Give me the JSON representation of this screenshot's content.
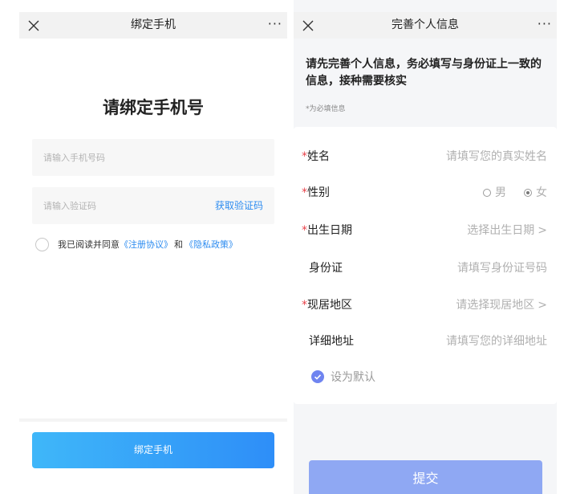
{
  "bind_phone": {
    "nav_title": "绑定手机",
    "more": "···",
    "page_title": "请绑定手机号",
    "phone_placeholder": "请输入手机号码",
    "code_placeholder": "请输入验证码",
    "get_code": "获取验证码",
    "agree_prefix": "我已阅读并同意",
    "register_agreement": "《注册协议》",
    "and": "和",
    "privacy_policy": "《隐私政策》",
    "submit": "绑定手机"
  },
  "profile": {
    "nav_title": "完善个人信息",
    "more": "···",
    "intro": "请先完善个人信息，务必填写与身份证上一致的信息，接种需要核实",
    "required_note": "*为必填信息",
    "fields": [
      {
        "required": true,
        "label": "姓名",
        "value": "请填写您的真实姓名"
      },
      {
        "required": true,
        "label": "性别",
        "options": [
          "男",
          "女"
        ],
        "selected": "女"
      },
      {
        "required": true,
        "label": "出生日期",
        "value": "选择出生日期"
      },
      {
        "required": false,
        "label": "身份证",
        "value": "请填写身份证号码"
      },
      {
        "required": true,
        "label": "现居地区",
        "value": "请选择现居地区"
      },
      {
        "required": false,
        "label": "详细地址",
        "value": "请填写您的详细地址"
      }
    ],
    "set_default": "设为默认",
    "submit": "提交"
  },
  "colors": {
    "accent": "#2d8cf0",
    "required": "#e8434b",
    "submit_disabled": "#8fa8f3"
  }
}
